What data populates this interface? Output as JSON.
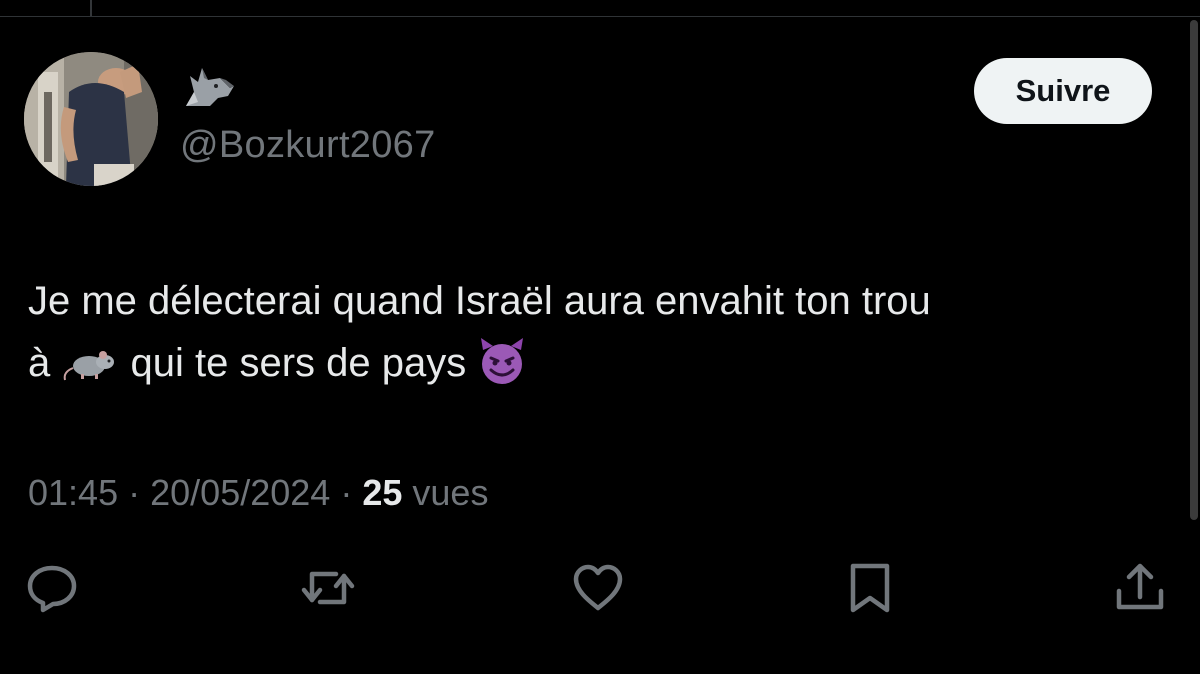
{
  "user": {
    "handle": "@Bozkurt2067",
    "display_name_icon": "wolf-icon"
  },
  "follow_button": {
    "label": "Suivre"
  },
  "tweet": {
    "line1": "Je me délecterai quand Israël aura envahit ton trou",
    "line2_part1": "à",
    "line2_emoji1": "rat-emoji",
    "line2_part2": "qui te sers de pays",
    "line2_emoji2": "smiling-imp-emoji"
  },
  "meta": {
    "time": "01:45",
    "separator": "·",
    "date": "20/05/2024",
    "views_count": "25",
    "views_label": "vues"
  },
  "actions": [
    "reply-icon",
    "retweet-icon",
    "like-icon",
    "bookmark-icon",
    "share-icon"
  ],
  "colors": {
    "background": "#000000",
    "text_primary": "#e7e9ea",
    "text_secondary": "#71767b",
    "button_bg": "#eff3f4",
    "button_text": "#0f1419"
  }
}
